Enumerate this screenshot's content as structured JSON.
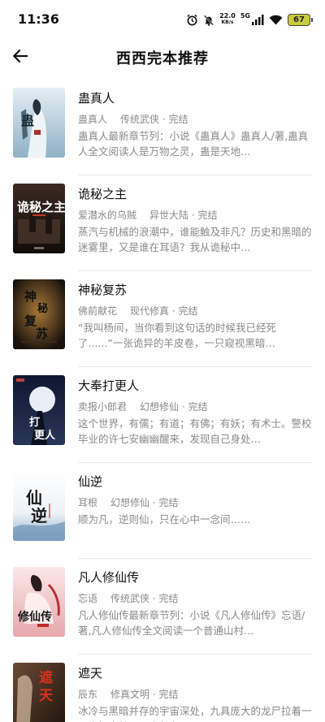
{
  "status_bar": {
    "time": "11:36",
    "net_speed_value": "22.0",
    "net_speed_unit": "KB/s",
    "net_type": "5G",
    "battery": "67"
  },
  "header": {
    "back_icon": "arrow-left-icon",
    "title": "西西完本推荐"
  },
  "books": [
    {
      "title": "蛊真人",
      "author": "蛊真人",
      "category": "传统武侠 · 完结",
      "desc": "蛊真人最新章节列：小说《蛊真人》蛊真人/著,蛊真人全文阅读人是万物之灵，蛊是天地…",
      "cover_colors": [
        "#cfe0ea",
        "#3b5d74"
      ]
    },
    {
      "title": "诡秘之主",
      "author": "爱潜水的乌贼",
      "category": "异世大陆 · 完结",
      "desc": "蒸汽与机械的浪潮中，谁能触及非凡？历史和黑暗的迷雾里，又是谁在耳语？我从诡秘中…",
      "cover_colors": [
        "#2a1c16",
        "#8a2b1a"
      ]
    },
    {
      "title": "神秘复苏",
      "author": "佛前献花",
      "category": "现代修真 · 完结",
      "desc": "“我叫杨间，当你看到这句话的时候我已经死了......”一张诡异的羊皮卷，一只窥视黑暗…",
      "cover_colors": [
        "#1f1610",
        "#8a5a26"
      ]
    },
    {
      "title": "大奉打更人",
      "author": "卖报小郎君",
      "category": "幻想修仙 · 完结",
      "desc": "这个世界，有儒；有道；有佛；有妖；有术士。警校毕业的许七安幽幽醒来，发现自己身处…",
      "cover_colors": [
        "#1a2340",
        "#5a6b92"
      ]
    },
    {
      "title": "仙逆",
      "author": "耳根",
      "category": "幻想修仙 · 完结",
      "desc": "顺为凡，逆则仙，只在心中一念间……",
      "cover_colors": [
        "#f4f6f8",
        "#9ab6cf"
      ]
    },
    {
      "title": "凡人修仙传",
      "author": "忘语",
      "category": "传统武侠 · 完结",
      "desc": "凡人修仙传最新章节列：小说《凡人修仙传》忘语/著,凡人修仙传全文阅读一个普通山村…",
      "cover_colors": [
        "#f5dcdc",
        "#b84a52"
      ]
    },
    {
      "title": "遮天",
      "author": "辰东",
      "category": "修真文明 · 完结",
      "desc": "冰冷与黑暗并存的宇宙深处，九具庞大的龙尸拉着一口青铜古棺，亘古长存…",
      "cover_colors": [
        "#3a2418",
        "#c04020"
      ]
    }
  ]
}
